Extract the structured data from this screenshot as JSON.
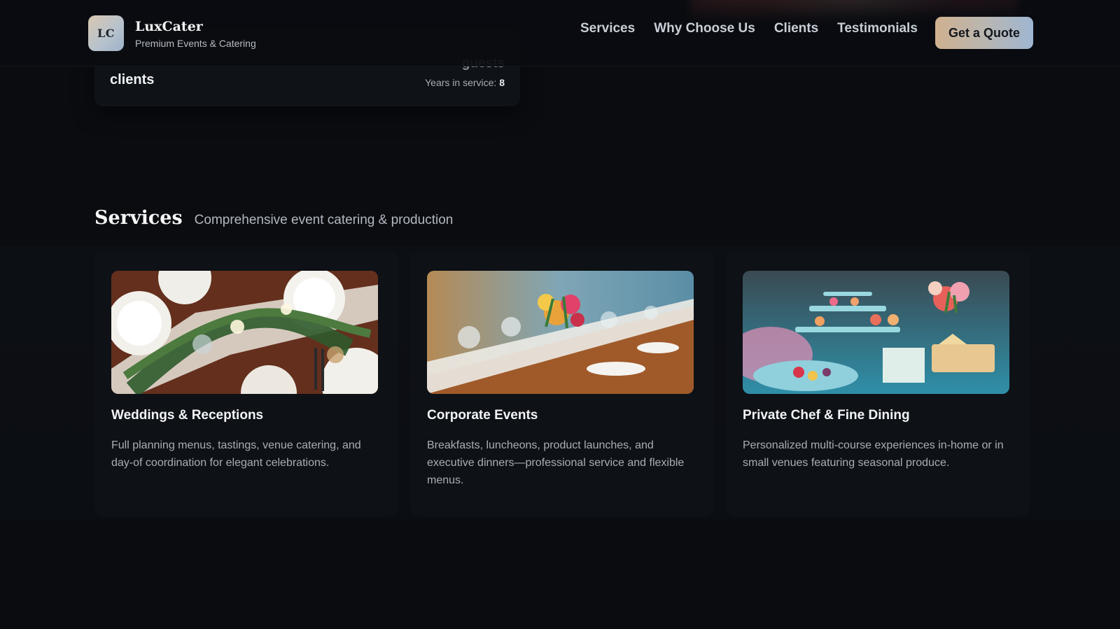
{
  "header": {
    "logo_initials": "LC",
    "brand_name": "LuxCater",
    "brand_tagline": "Premium Events & Catering",
    "nav": [
      {
        "label": "Services"
      },
      {
        "label": "Why Choose Us"
      },
      {
        "label": "Clients"
      },
      {
        "label": "Testimonials"
      }
    ],
    "cta_label": "Get a Quote"
  },
  "stats": {
    "clients_label": "clients",
    "guests_label": "guests",
    "years_label": "Years in service:",
    "years_value": "8"
  },
  "services": {
    "title": "Services",
    "subtitle": "Comprehensive event catering & production",
    "cards": [
      {
        "image": "wedding-table-photo",
        "title": "Weddings & Receptions",
        "description": "Full planning menus, tastings, venue catering, and day-of coordination for elegant celebrations."
      },
      {
        "image": "corporate-banquet-photo",
        "title": "Corporate Events",
        "description": "Breakfasts, luncheons, product launches, and executive dinners—professional service and flexible menus."
      },
      {
        "image": "dessert-buffet-photo",
        "title": "Private Chef & Fine Dining",
        "description": "Personalized multi-course experiences in-home or in small venues featuring seasonal produce."
      }
    ]
  },
  "colors": {
    "background": "#0a0c10",
    "card": "#0e1116",
    "accent_gradient_start": "#cfb08f",
    "accent_gradient_end": "#9fb6d2"
  }
}
